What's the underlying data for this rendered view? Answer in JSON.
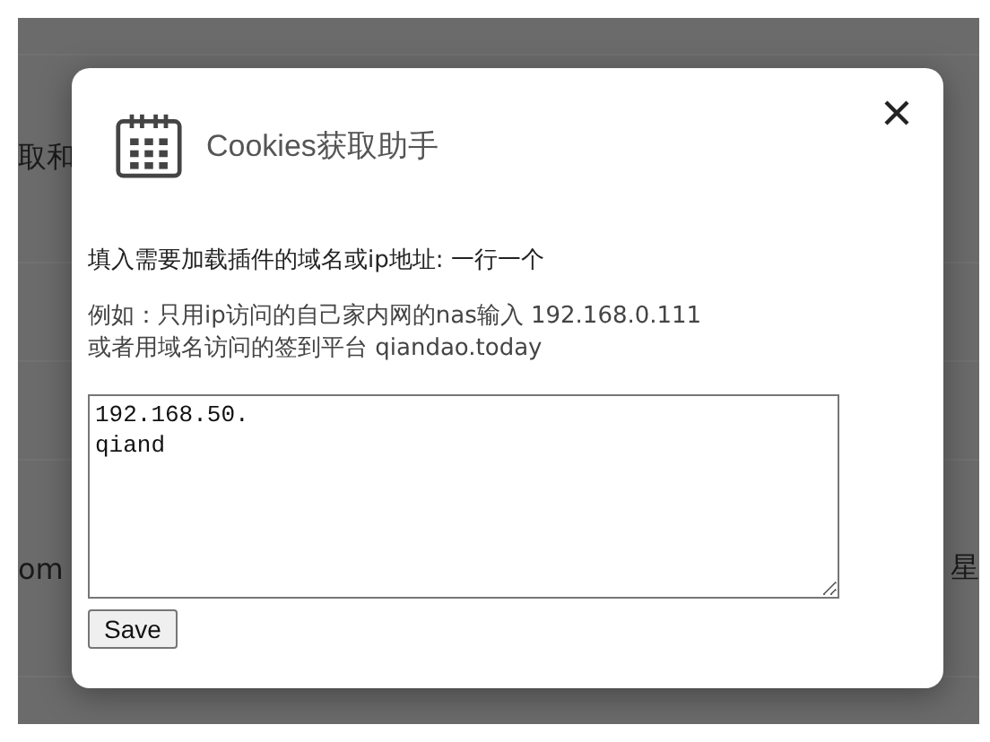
{
  "background_page": {
    "upper_left_text": "取和",
    "lower_left_text": "om",
    "lower_right_text": "星"
  },
  "dialog": {
    "title": "Cookies获取助手",
    "instruction": "填入需要加载插件的域名或ip地址: 一行一个",
    "example_lines": [
      "例如：只用ip访问的自己家内网的nas输入 192.168.0.111",
      "或者用域名访问的签到平台 qiandao.today"
    ],
    "domains_field": {
      "lines": [
        "192.168.50.",
        "qiand"
      ]
    },
    "save_button": "Save"
  }
}
